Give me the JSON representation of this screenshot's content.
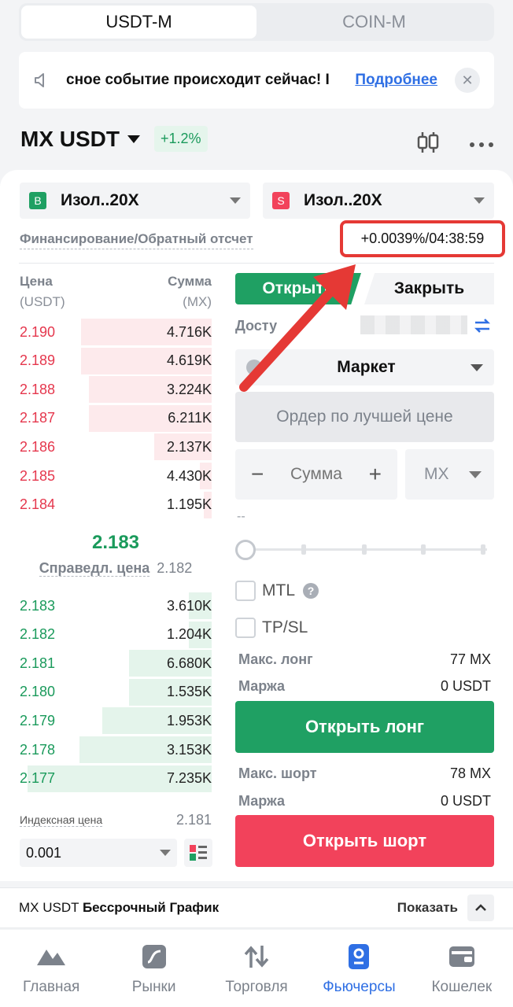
{
  "colors": {
    "green": "#1fa063",
    "red": "#f2425b",
    "blue": "#2f6fe4",
    "annotation": "#e53935"
  },
  "top_tabs": {
    "usdt_m": "USDT-M",
    "coin_m": "COIN-M"
  },
  "announcement": {
    "text": "сное событие происходит сейчас! I",
    "link": "Подробнее",
    "icon": "megaphone-icon"
  },
  "symbol": {
    "name": "MX USDT",
    "change": "+1.2%"
  },
  "margin_mode": {
    "buy": {
      "badge": "B",
      "label": "Изол..20X"
    },
    "sell": {
      "badge": "S",
      "label": "Изол..20X"
    }
  },
  "funding": {
    "label": "Финансирование/Обратный отсчет",
    "value": "+0.0039%/04:38:59"
  },
  "orderbook": {
    "price_header": "Цена",
    "price_unit": "(USDT)",
    "amount_header": "Сумма",
    "amount_unit": "(MX)",
    "asks": [
      {
        "price": "2.190",
        "amount": "4.716K",
        "depth": 0.68
      },
      {
        "price": "2.189",
        "amount": "4.619K",
        "depth": 0.68
      },
      {
        "price": "2.188",
        "amount": "3.224K",
        "depth": 0.64
      },
      {
        "price": "2.187",
        "amount": "6.211K",
        "depth": 0.64
      },
      {
        "price": "2.186",
        "amount": "2.137K",
        "depth": 0.3
      },
      {
        "price": "2.185",
        "amount": "4.430K",
        "depth": 0.06
      },
      {
        "price": "2.184",
        "amount": "1.195K",
        "depth": 0.04
      }
    ],
    "mid_price": "2.183",
    "fair_price_label": "Справедл. цена",
    "fair_price_value": "2.182",
    "bids": [
      {
        "price": "2.183",
        "amount": "3.610K",
        "depth": 0.12
      },
      {
        "price": "2.182",
        "amount": "1.204K",
        "depth": 0.12
      },
      {
        "price": "2.181",
        "amount": "6.680K",
        "depth": 0.43
      },
      {
        "price": "2.180",
        "amount": "1.535K",
        "depth": 0.43
      },
      {
        "price": "2.179",
        "amount": "1.953K",
        "depth": 0.57
      },
      {
        "price": "2.178",
        "amount": "3.153K",
        "depth": 0.69
      },
      {
        "price": "2.177",
        "amount": "7.235K",
        "depth": 0.96
      }
    ],
    "index_label": "Индексная цена",
    "index_value": "2.181",
    "precision": "0.001"
  },
  "trade": {
    "tab_open": "Открыть",
    "tab_close": "Закрыть",
    "available_label": "Досту",
    "order_type": "Маркет",
    "best_price": "Ордер по лучшей цене",
    "amount_placeholder": "Сумма",
    "unit": "MX",
    "dashes": "--",
    "slider_percent": 0,
    "mtl": "MTL",
    "tpsl": "TP/SL",
    "max_long_label": "Макс. лонг",
    "max_long_value": "77 MX",
    "margin_label": "Маржа",
    "margin_long_value": "0 USDT",
    "open_long": "Открыть лонг",
    "max_short_label": "Макс. шорт",
    "max_short_value": "78 MX",
    "margin_short_value": "0 USDT",
    "open_short": "Открыть шорт"
  },
  "chart_bar": {
    "symbol": "MX USDT",
    "title": "Бессрочный График",
    "show": "Показать"
  },
  "nav": [
    {
      "label": "Главная",
      "icon": "home-icon"
    },
    {
      "label": "Рынки",
      "icon": "markets-icon"
    },
    {
      "label": "Торговля",
      "icon": "trade-icon"
    },
    {
      "label": "Фьючерсы",
      "icon": "futures-icon"
    },
    {
      "label": "Кошелек",
      "icon": "wallet-icon"
    }
  ]
}
